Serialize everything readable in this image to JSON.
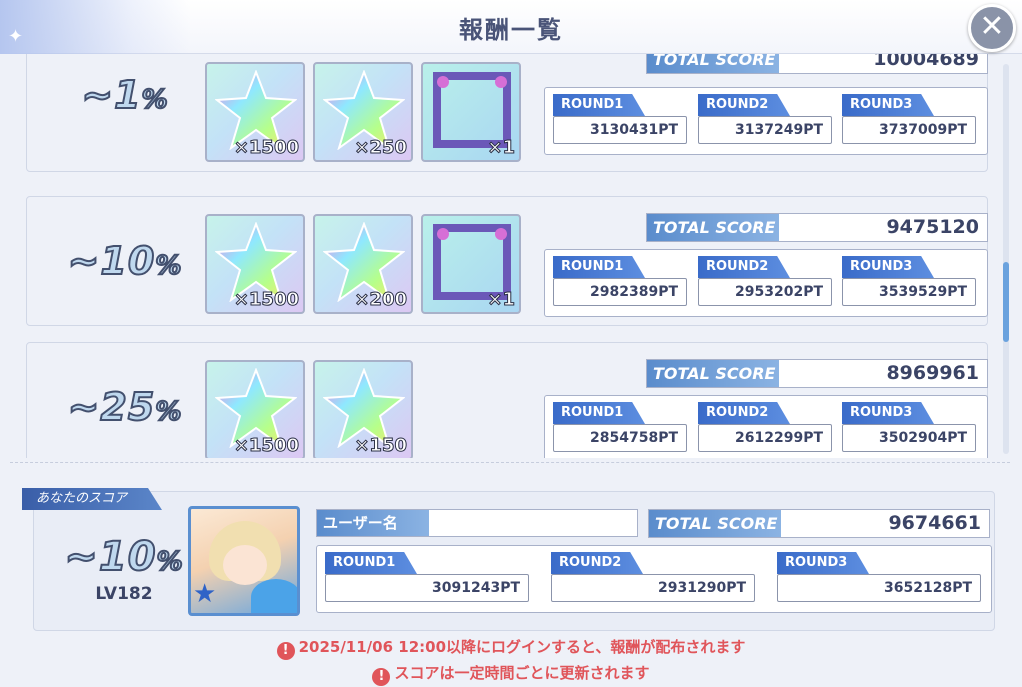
{
  "header": {
    "title": "報酬一覧",
    "close_icon": "close-icon"
  },
  "tiers": [
    {
      "rank": "~1",
      "rank_unit": "%",
      "items": [
        {
          "icon": "rainbow-star-icon",
          "qty": "×1500"
        },
        {
          "icon": "rainbow-star-icon",
          "qty": "×250"
        },
        {
          "icon": "frame-icon",
          "qty": "×1"
        }
      ],
      "total_label": "TOTAL SCORE",
      "total": "10004689",
      "rounds": [
        {
          "label": "ROUND1",
          "pt": "3130431PT"
        },
        {
          "label": "ROUND2",
          "pt": "3137249PT"
        },
        {
          "label": "ROUND3",
          "pt": "3737009PT"
        }
      ]
    },
    {
      "rank": "~10",
      "rank_unit": "%",
      "items": [
        {
          "icon": "rainbow-star-icon",
          "qty": "×1500"
        },
        {
          "icon": "rainbow-star-icon",
          "qty": "×200"
        },
        {
          "icon": "frame-icon",
          "qty": "×1"
        }
      ],
      "total_label": "TOTAL SCORE",
      "total": "9475120",
      "rounds": [
        {
          "label": "ROUND1",
          "pt": "2982389PT"
        },
        {
          "label": "ROUND2",
          "pt": "2953202PT"
        },
        {
          "label": "ROUND3",
          "pt": "3539529PT"
        }
      ]
    },
    {
      "rank": "~25",
      "rank_unit": "%",
      "items": [
        {
          "icon": "rainbow-star-icon",
          "qty": "×1500"
        },
        {
          "icon": "rainbow-star-icon",
          "qty": "×150"
        }
      ],
      "total_label": "TOTAL SCORE",
      "total": "8969961",
      "rounds": [
        {
          "label": "ROUND1",
          "pt": "2854758PT"
        },
        {
          "label": "ROUND2",
          "pt": "2612299PT"
        },
        {
          "label": "ROUND3",
          "pt": "3502904PT"
        }
      ]
    }
  ],
  "my_score": {
    "tag": "あなたのスコア",
    "rank": "~10",
    "rank_unit": "%",
    "level": "LV182",
    "username_label": "ユーザー名",
    "username": "",
    "total_label": "TOTAL SCORE",
    "total": "9674661",
    "rounds": [
      {
        "label": "ROUND1",
        "pt": "3091243PT"
      },
      {
        "label": "ROUND2",
        "pt": "2931290PT"
      },
      {
        "label": "ROUND3",
        "pt": "3652128PT"
      }
    ]
  },
  "notices": [
    "2025/11/06 12:00以降にログインすると、報酬が配布されます",
    "スコアは一定時間ごとに更新されます"
  ],
  "notice_icon": "!",
  "colors": {
    "accent": "#5a8ccc",
    "round_tag": "#3a6bc9",
    "warning": "#e0555a"
  }
}
